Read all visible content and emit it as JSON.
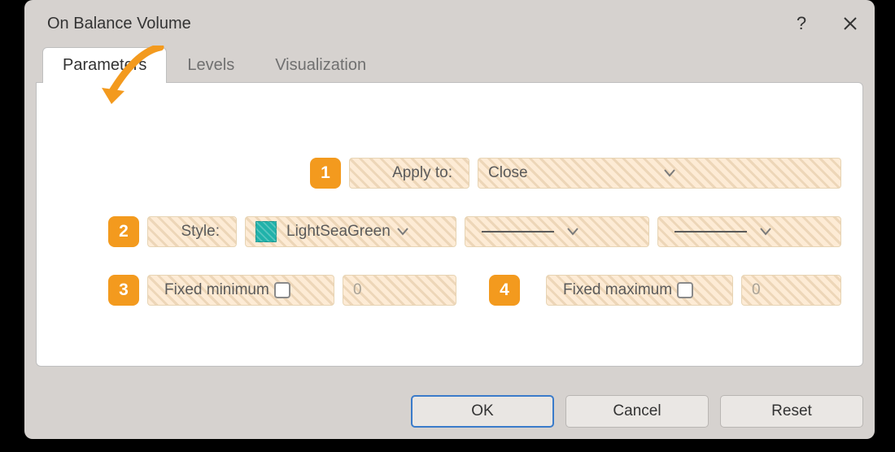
{
  "title": "On Balance Volume",
  "titlebar": {
    "help_symbol": "?",
    "close_symbol": "✕"
  },
  "tabs": {
    "parameters": "Parameters",
    "levels": "Levels",
    "visualization": "Visualization"
  },
  "badges": {
    "b1": "1",
    "b2": "2",
    "b3": "3",
    "b4": "4"
  },
  "rows": {
    "apply_to": {
      "label": "Apply to:",
      "value": "Close"
    },
    "style": {
      "label": "Style:",
      "color_name": "LightSeaGreen"
    },
    "fixed_min": {
      "label": "Fixed minimum",
      "value": "0"
    },
    "fixed_max": {
      "label": "Fixed maximum",
      "value": "0"
    }
  },
  "buttons": {
    "ok": "OK",
    "cancel": "Cancel",
    "reset": "Reset"
  }
}
